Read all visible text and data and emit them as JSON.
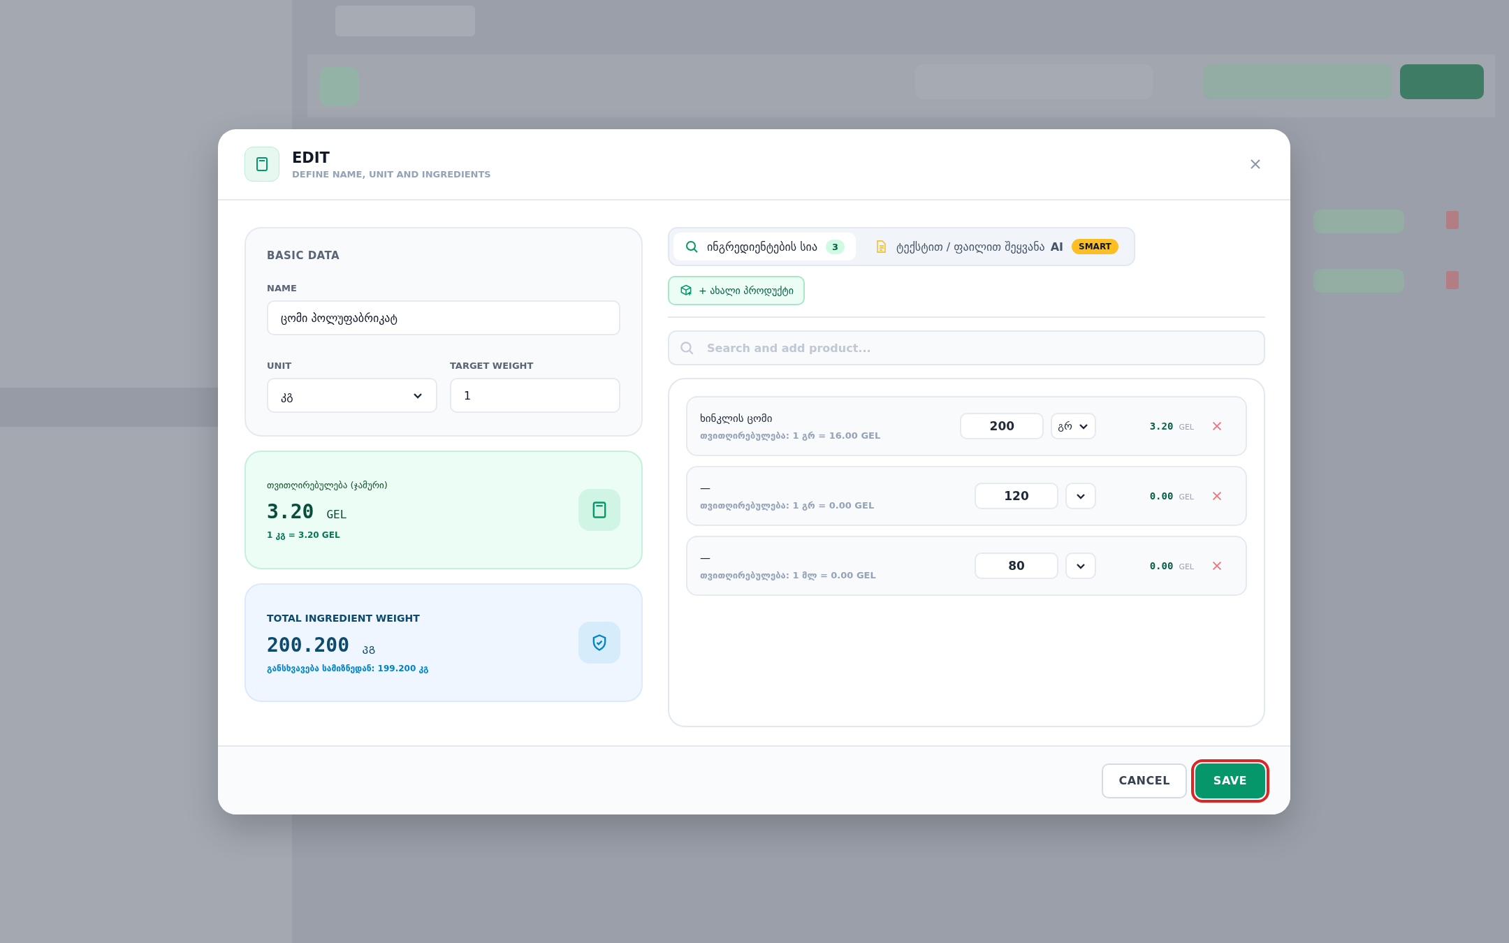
{
  "dialog": {
    "title": "EDIT",
    "subtitle": "DEFINE NAME, UNIT AND INGREDIENTS"
  },
  "basic_data": {
    "heading": "BASIC DATA",
    "name_label": "NAME",
    "name_value": "ცომი პოლუფაბრიკატ",
    "unit_label": "UNIT",
    "unit_value": "კგ",
    "target_label": "TARGET WEIGHT",
    "target_value": "1"
  },
  "cost_card": {
    "label": "თვითღირებულება (ჯამური)",
    "amount": "3.20",
    "currency": "GEL",
    "note": "1 კგ = 3.20 GEL"
  },
  "weight_card": {
    "label": "TOTAL INGREDIENT WEIGHT",
    "amount": "200.200",
    "unit": "კგ",
    "note": "განსხვავება სამიზნედან: 199.200 კგ"
  },
  "tabs": [
    {
      "kind": "list",
      "label": "ინგრედიენტების სია",
      "count": "3",
      "selected": true
    },
    {
      "kind": "ai",
      "label": "ტექსტით / ფაილით შეყვანა",
      "suffix": "AI",
      "badge": "SMART",
      "selected": false
    }
  ],
  "new_product_button": "+ ახალი პროდუქტი",
  "search": {
    "placeholder": "Search and add product..."
  },
  "ingredients": [
    {
      "name": "ხინკლის ცომი",
      "cost_note": "თვითღირებულება: 1 გრ = 16.00 GEL",
      "quantity": "200",
      "unit": "გრ",
      "total": "3.20",
      "currency": "GEL"
    },
    {
      "name": "—",
      "cost_note": "თვითღირებულება: 1 გრ = 0.00 GEL",
      "quantity": "120",
      "total": "0.00",
      "currency": "GEL"
    },
    {
      "name": "—",
      "cost_note": "თვითღირებულება: 1 მლ = 0.00 GEL",
      "quantity": "80",
      "total": "0.00",
      "currency": "GEL"
    }
  ],
  "buttons": [
    {
      "kind": "cancel",
      "label": "CANCEL",
      "focused": false
    },
    {
      "kind": "save",
      "label": "SAVE",
      "focused": true
    }
  ]
}
